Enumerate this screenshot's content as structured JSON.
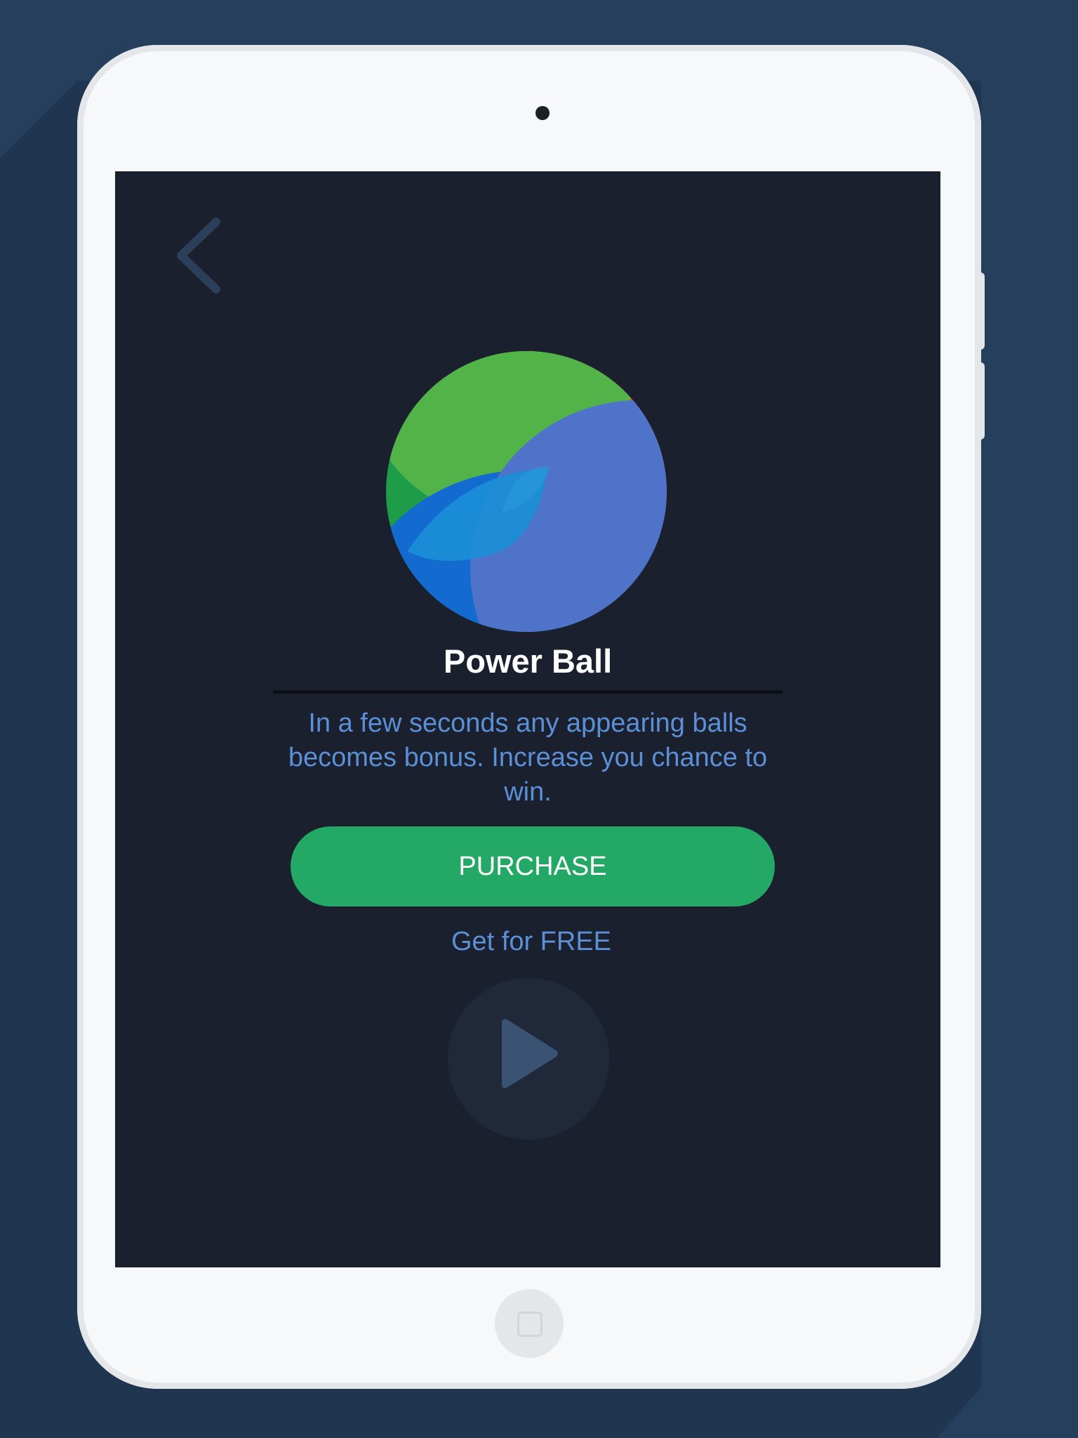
{
  "background_color": "#253f5d",
  "screen": {
    "background_color": "#1a202d",
    "back_icon": "chevron-left-icon",
    "item": {
      "icon": "power-ball-icon",
      "title": "Power Ball",
      "description": "In a few seconds any appearing balls becomes bonus. Increase you chance to win."
    },
    "purchase_label": "PURCHASE",
    "free_label": "Get for FREE",
    "play_icon": "play-icon"
  },
  "colors": {
    "accent_green": "#23a865",
    "link_blue": "#5b8fd6",
    "ball_green": "#52b448",
    "ball_orange": "#dd7e0f",
    "ball_red": "#ff3128",
    "ball_blue": "#4e73c9",
    "ball_dark_blue": "#136bd0"
  },
  "device": {
    "home_icon": "home-button-icon"
  }
}
